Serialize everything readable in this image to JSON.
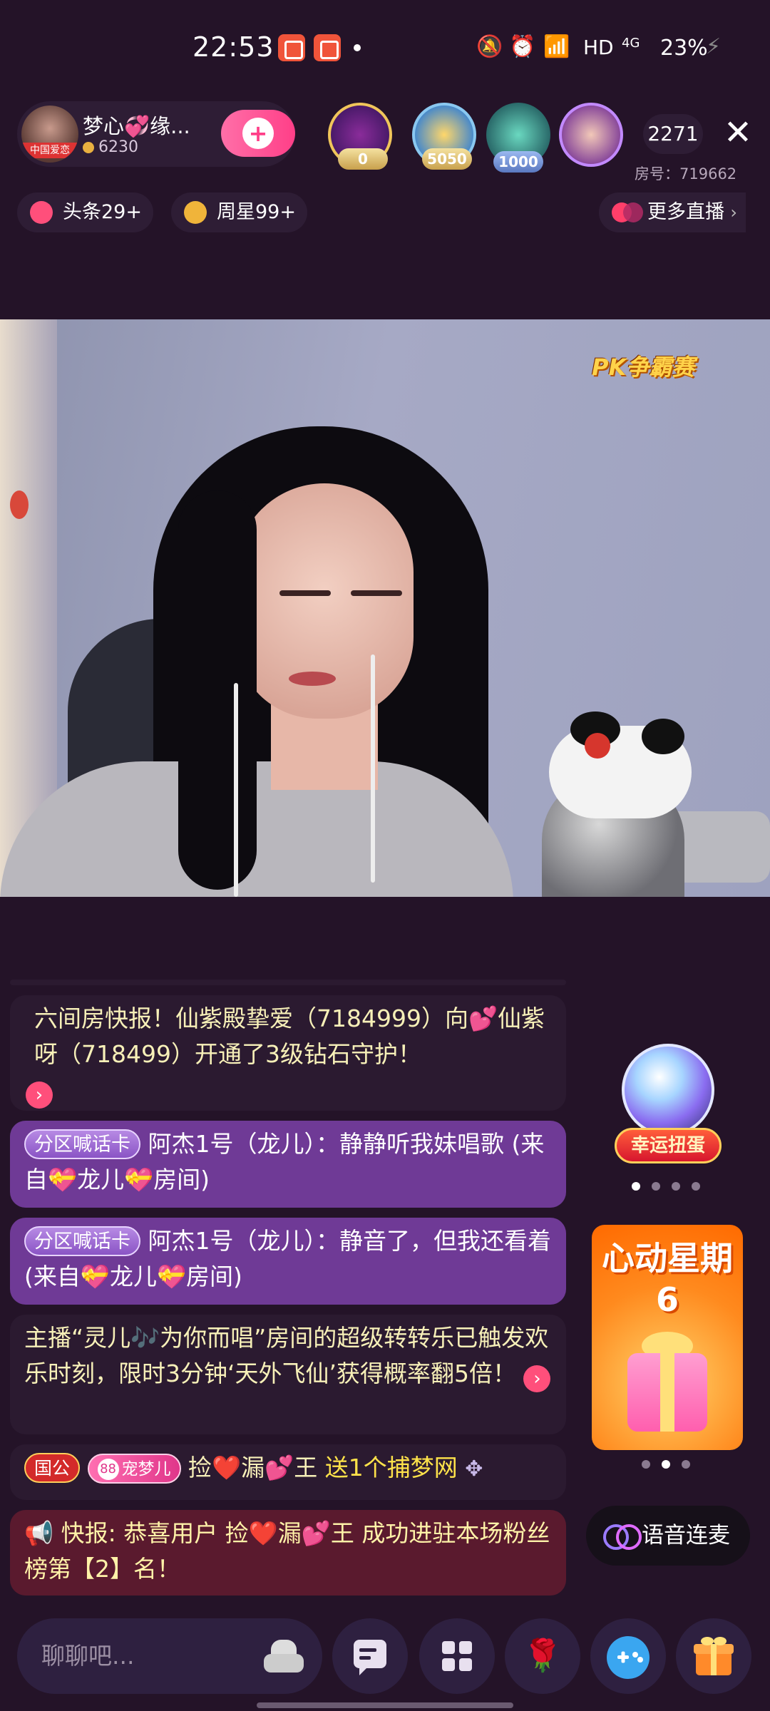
{
  "status_bar": {
    "time": "22:53",
    "network": "HD",
    "signal": "4G",
    "battery": "23%"
  },
  "host": {
    "name": "梦心💞缘...",
    "coins": "6230",
    "avatar_ribbon": "中国爱恋"
  },
  "rankings": [
    {
      "badge": "0"
    },
    {
      "badge": "5050"
    },
    {
      "badge": "1000"
    },
    {
      "badge": ""
    }
  ],
  "viewer_count": "2271",
  "room_number": "房号：719662",
  "chips": {
    "headline": "头条29+",
    "weekly_star": "周星99+",
    "more_live": "更多直播"
  },
  "video": {
    "pk_badge": "PK争霸赛"
  },
  "chat": [
    {
      "type": "broadcast",
      "text": "六间房快报！仙紫殿挚爱（7184999）向💕仙紫呀（718499）开通了3级钻石守护！"
    },
    {
      "type": "shout",
      "tag": "分区喊话卡",
      "user": "阿杰1号（龙儿）",
      "text": "：静静听我妹唱歌 (来自💝龙儿💝房间)"
    },
    {
      "type": "shout",
      "tag": "分区喊话卡",
      "user": "阿杰1号（龙儿）",
      "text": "：静音了，但我还看着 (来自💝龙儿💝房间)"
    },
    {
      "type": "event",
      "text": "主播“灵儿🎶为你而唱”房间的超级转转乐已触发欢乐时刻，限时3分钟‘天外飞仙’获得概率翻5倍！"
    },
    {
      "type": "gift",
      "badge1": "国公",
      "badge2_level": "88",
      "badge2_name": "宠梦儿",
      "user": "捡❤️漏💕王",
      "text": "送1个捕梦网"
    },
    {
      "type": "announcement",
      "text": "快报: 恭喜用户 捡❤️漏💕王 成功进驻本场粉丝榜第【2】名！"
    }
  ],
  "widgets": {
    "lucky_egg": "幸运扭蛋",
    "promo_title": "心动星期6",
    "voice_link": "语音连麦"
  },
  "bottom_bar": {
    "chat_placeholder": "聊聊吧..."
  }
}
